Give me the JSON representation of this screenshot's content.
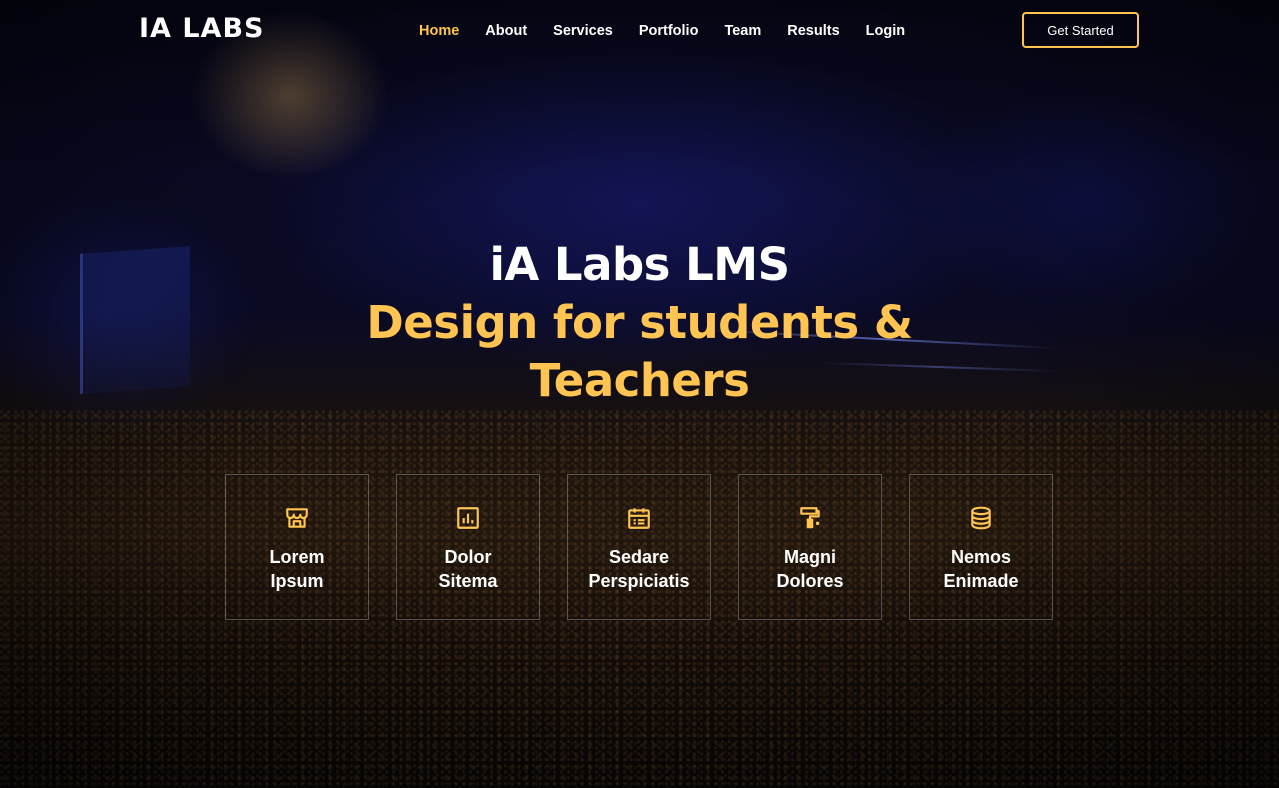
{
  "brand": {
    "logo": "IA LABS",
    "accent": "#ffc451"
  },
  "nav": {
    "items": [
      {
        "label": "Home",
        "active": true
      },
      {
        "label": "About",
        "active": false
      },
      {
        "label": "Services",
        "active": false
      },
      {
        "label": "Portfolio",
        "active": false
      },
      {
        "label": "Team",
        "active": false
      },
      {
        "label": "Results",
        "active": false
      },
      {
        "label": "Login",
        "active": false
      }
    ],
    "cta_label": "Get Started"
  },
  "hero": {
    "title": "iA Labs LMS",
    "subtitle_line1": "Design for students &",
    "subtitle_line2": "Teachers"
  },
  "features": [
    {
      "icon": "store-icon",
      "line1": "Lorem",
      "line2": "Ipsum"
    },
    {
      "icon": "bar-chart-icon",
      "line1": "Dolor",
      "line2": "Sitema"
    },
    {
      "icon": "calendar-todo-icon",
      "line1": "Sedare",
      "line2": "Perspiciatis"
    },
    {
      "icon": "paint-roller-icon",
      "line1": "Magni",
      "line2": "Dolores"
    },
    {
      "icon": "database-icon",
      "line1": "Nemos",
      "line2": "Enimade"
    }
  ]
}
